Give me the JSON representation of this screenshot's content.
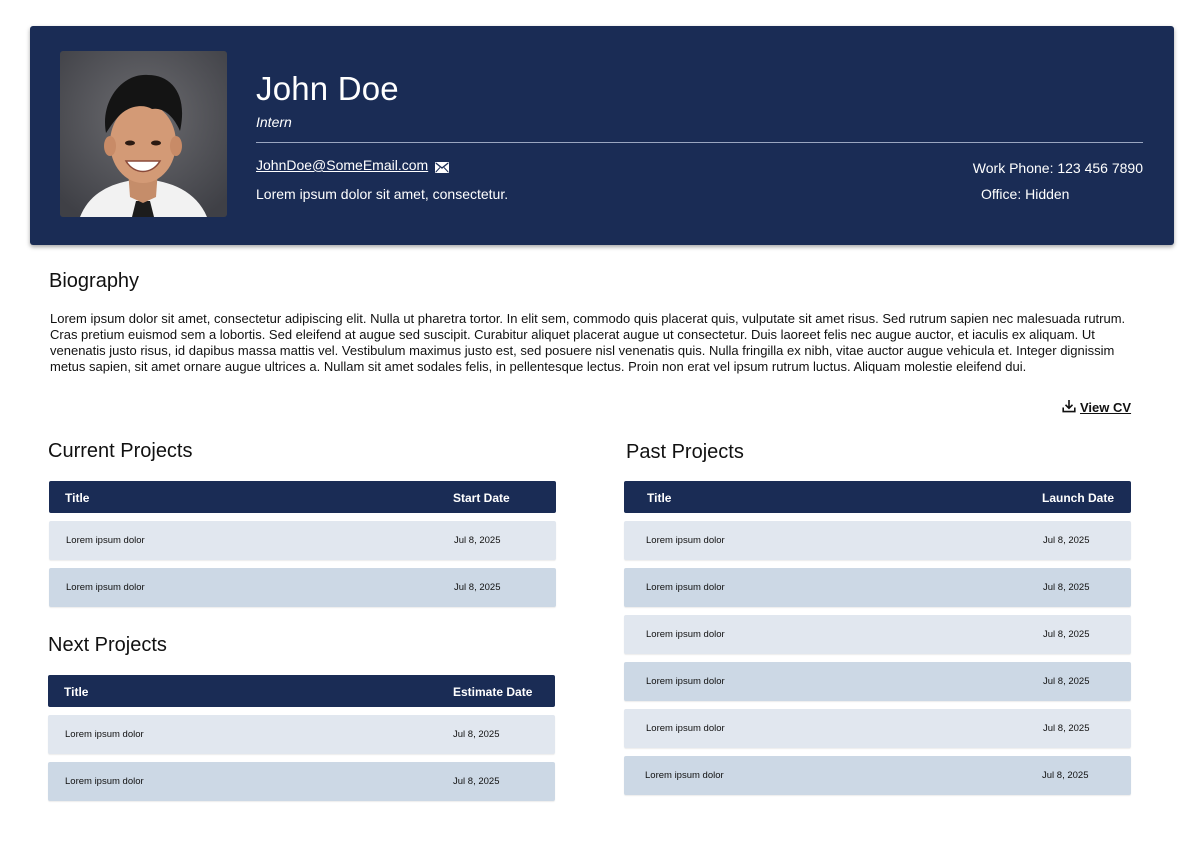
{
  "profile": {
    "name": "John Doe",
    "role": "Intern",
    "email": "JohnDoe@SomeEmail.com",
    "tagline": "Lorem ipsum dolor sit amet, consectetur.",
    "work_phone": "Work Phone: 123 456 7890",
    "office": "Office: Hidden"
  },
  "biography": {
    "title": "Biography",
    "text": "Lorem ipsum dolor sit amet, consectetur adipiscing elit. Nulla ut pharetra tortor. In elit sem, commodo quis placerat quis, vulputate sit amet risus. Sed rutrum sapien nec malesuada rutrum. Cras pretium euismod sem a lobortis. Sed eleifend at augue sed suscipit. Curabitur aliquet placerat augue ut consectetur. Duis laoreet felis nec augue auctor, et iaculis ex aliquam. Ut venenatis justo risus, id dapibus massa mattis vel. Vestibulum maximus justo est, sed posuere nisl venenatis quis. Nulla fringilla ex nibh, vitae auctor augue vehicula et. Integer dignissim metus sapien, sit amet ornare augue ultrices a. Nullam sit amet sodales felis, in pellentesque lectus. Proin non erat vel ipsum rutrum luctus. Aliquam molestie eleifend dui.",
    "view_cv_label": "View CV"
  },
  "current_projects": {
    "title": "Current Projects",
    "columns": [
      "Title",
      "Start Date"
    ],
    "rows": [
      [
        "Lorem ipsum dolor",
        "Jul 8, 2025"
      ],
      [
        "Lorem ipsum dolor",
        "Jul 8, 2025"
      ]
    ]
  },
  "next_projects": {
    "title": "Next Projects",
    "columns": [
      "Title",
      "Estimate Date"
    ],
    "rows": [
      [
        "Lorem ipsum dolor",
        "Jul 8, 2025"
      ],
      [
        "Lorem ipsum dolor",
        "Jul 8, 2025"
      ]
    ]
  },
  "past_projects": {
    "title": "Past Projects",
    "columns": [
      "Title",
      "Launch Date"
    ],
    "rows": [
      [
        "Lorem ipsum dolor",
        "Jul 8, 2025"
      ],
      [
        "Lorem ipsum dolor",
        "Jul 8, 2025"
      ],
      [
        "Lorem ipsum dolor",
        "Jul 8, 2025"
      ],
      [
        "Lorem ipsum dolor",
        "Jul 8, 2025"
      ],
      [
        "Lorem ipsum dolor",
        "Jul 8, 2025"
      ],
      [
        "Lorem ipsum dolor",
        "Jul 8, 2025"
      ]
    ]
  },
  "colors": {
    "header_bg": "#1a2c55",
    "row_light": "#e1e7ef",
    "row_dark": "#ccd8e5"
  },
  "icons": {
    "email": "envelope-icon",
    "download": "download-icon"
  }
}
